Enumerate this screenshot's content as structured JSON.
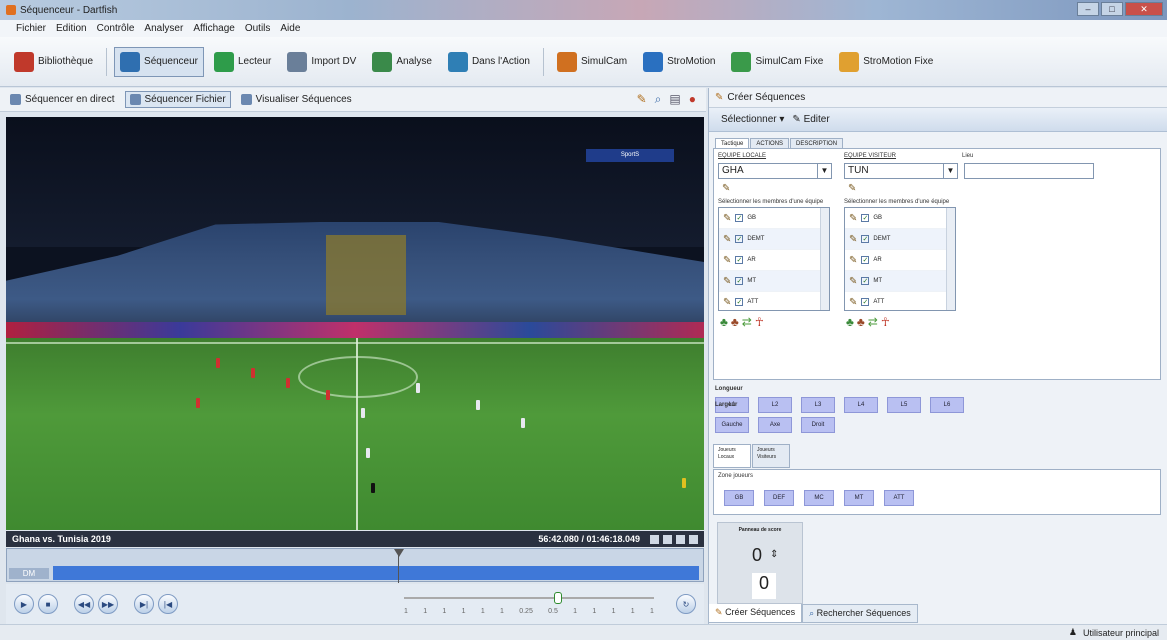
{
  "window": {
    "title": "Séquenceur - Dartfish",
    "min": "–",
    "max": "□",
    "close": "✕"
  },
  "menu": [
    "Fichier",
    "Edition",
    "Contrôle",
    "Analyser",
    "Affichage",
    "Outils",
    "Aide"
  ],
  "toolbar": [
    {
      "label": "Bibliothèque",
      "color": "#c0392b"
    },
    {
      "label": "Séquenceur",
      "color": "#2f6fb0",
      "active": true
    },
    {
      "label": "Lecteur",
      "color": "#2e9c4a"
    },
    {
      "label": "Import DV",
      "color": "#6a7f99"
    },
    {
      "label": "Analyse",
      "color": "#3a8a4a"
    },
    {
      "label": "Dans l'Action",
      "color": "#2f7fb5"
    },
    {
      "label": "SimulCam",
      "color": "#d07020"
    },
    {
      "label": "StroMotion",
      "color": "#2a70c0"
    },
    {
      "label": "SimulCam Fixe",
      "color": "#3a9a4a"
    },
    {
      "label": "StroMotion Fixe",
      "color": "#e0a030"
    }
  ],
  "subtabs": {
    "live": "Séquencer en direct",
    "file": "Séquencer Fichier",
    "view": "Visualiser Séquences"
  },
  "video": {
    "scorebug": "SportS",
    "title": "Ghana vs. Tunisia 2019",
    "timecode": "56:42.080 / 01:46:18.049"
  },
  "timeline": {
    "label": "DM"
  },
  "speed_ticks": [
    "1",
    "1",
    "1",
    "1",
    "1",
    "1",
    "0.25",
    "0.5",
    "1",
    "1",
    "1",
    "1",
    "1"
  ],
  "right_panel": {
    "header": "Créer Séquences",
    "select_label": "Sélectionner",
    "edit_label": "Editer",
    "tabs": [
      "Tactique",
      "ACTIONS",
      "DESCRIPTION"
    ],
    "home_label": "EQUIPE LOCALE",
    "away_label": "EQUIPE VISITEUR",
    "place_label": "Lieu",
    "home_team": "GHA",
    "away_team": "TUN",
    "list_caption": "Sélectionner les membres d'une équipe",
    "players": [
      "GB",
      "DEF",
      "MC",
      "MT",
      "ATT"
    ],
    "players_shown": [
      "GB",
      "DEMT",
      "AR",
      "MT",
      "ATT"
    ],
    "longueur_label": "Longueur",
    "longueur": [
      "L1",
      "L2",
      "L3",
      "L4",
      "L5",
      "L6"
    ],
    "largeur_label": "Largeur",
    "largeur": [
      "Gauche",
      "Axe",
      "Droit"
    ],
    "zone_tabs": [
      "Joueurs Locaux",
      "Joueurs Visiteurs"
    ],
    "zone_label": "Zone joueurs",
    "zones": [
      "GB",
      "DEF",
      "MC",
      "MT",
      "ATT"
    ],
    "score_title": "Panneau de score",
    "score_top": "0",
    "score_bottom": "0"
  },
  "bottom_tabs": [
    "Créer Séquences",
    "Rechercher Séquences"
  ],
  "status": "Utilisateur principal"
}
